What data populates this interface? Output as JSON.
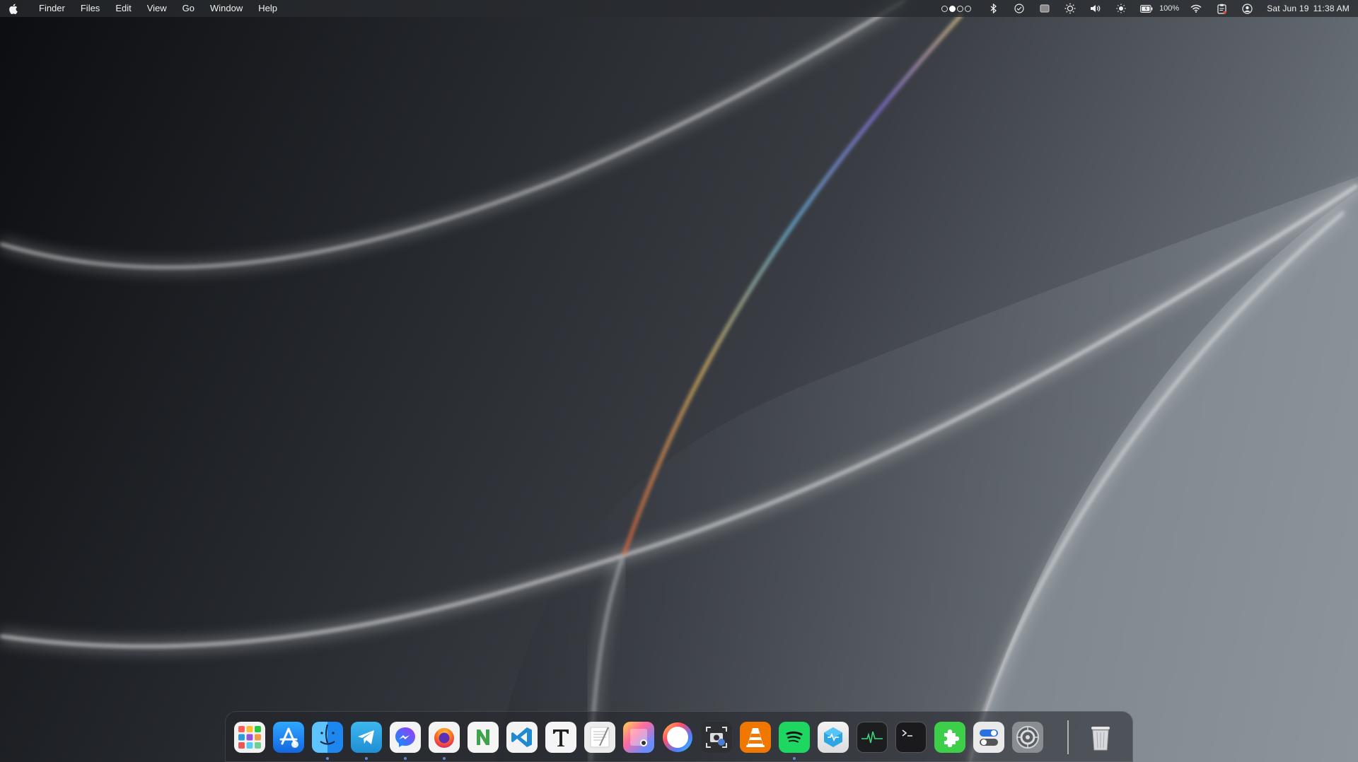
{
  "menubar": {
    "app_name": "Finder",
    "menus": [
      "Files",
      "Edit",
      "View",
      "Go",
      "Window",
      "Help"
    ],
    "battery_percent": "100%",
    "date": "Sat Jun 19",
    "time": "11:38 AM",
    "status_icons": [
      "page-dots-icon",
      "bluetooth-icon",
      "checkmark-circle-icon",
      "screen-icon",
      "brightness-gear-icon",
      "volume-icon",
      "brightness-icon",
      "battery-icon",
      "wifi-icon",
      "clipboard-icon",
      "user-circle-icon"
    ]
  },
  "dock": {
    "apps": [
      {
        "name": "Launchpad",
        "icon": "launchpad-icon",
        "running": false
      },
      {
        "name": "App Store",
        "icon": "app-store-icon",
        "running": false
      },
      {
        "name": "Finder",
        "icon": "finder-icon",
        "running": true
      },
      {
        "name": "Telegram",
        "icon": "telegram-icon",
        "running": true
      },
      {
        "name": "Messenger",
        "icon": "messenger-icon",
        "running": true
      },
      {
        "name": "Firefox",
        "icon": "firefox-icon",
        "running": true
      },
      {
        "name": "Notion-like N",
        "icon": "n-app-icon",
        "running": false
      },
      {
        "name": "Visual Studio Code",
        "icon": "vscode-icon",
        "running": false
      },
      {
        "name": "Typora",
        "icon": "typora-icon",
        "running": false
      },
      {
        "name": "TextEdit",
        "icon": "textedit-icon",
        "running": false
      },
      {
        "name": "Preview",
        "icon": "preview-icon",
        "running": false
      },
      {
        "name": "Circle App",
        "icon": "circle-app-icon",
        "running": false
      },
      {
        "name": "Screenshot",
        "icon": "screenshot-icon",
        "running": false
      },
      {
        "name": "VLC",
        "icon": "vlc-icon",
        "running": false
      },
      {
        "name": "Spotify",
        "icon": "spotify-icon",
        "running": true
      },
      {
        "name": "Cube App",
        "icon": "cube-app-icon",
        "running": false
      },
      {
        "name": "Activity Monitor",
        "icon": "activity-monitor-icon",
        "running": false
      },
      {
        "name": "Terminal",
        "icon": "terminal-icon",
        "running": false
      },
      {
        "name": "Extensions",
        "icon": "puzzle-icon",
        "running": false
      },
      {
        "name": "Toggle App",
        "icon": "toggle-icon",
        "running": false
      },
      {
        "name": "System Preferences",
        "icon": "settings-gear-icon",
        "running": false
      },
      {
        "name": "Trash",
        "icon": "trash-icon",
        "running": false
      }
    ]
  },
  "colors": {
    "menubar_bg": "#2a2c30",
    "running_dot": "#5a8ad8"
  }
}
